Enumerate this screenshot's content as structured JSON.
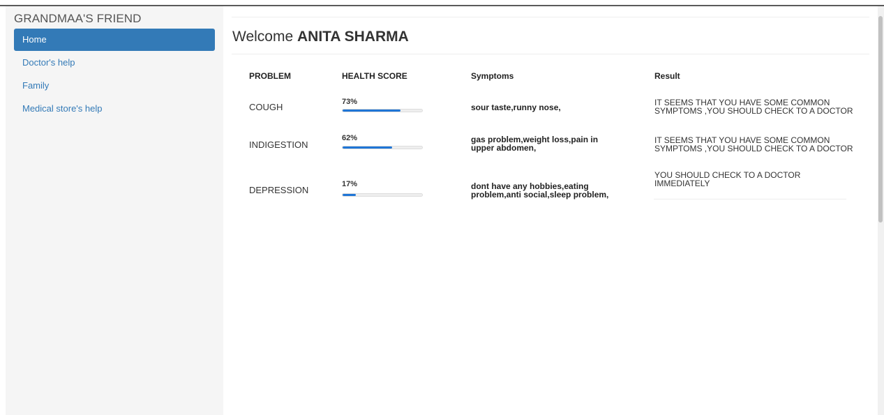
{
  "brand": "GRANDMAA'S FRIEND",
  "nav": [
    {
      "label": "Home",
      "active": true
    },
    {
      "label": "Doctor's help",
      "active": false
    },
    {
      "label": "Family",
      "active": false
    },
    {
      "label": "Medical store's help",
      "active": false
    }
  ],
  "welcome": {
    "prefix": "Welcome",
    "name": "ANITA SHARMA"
  },
  "table": {
    "headers": {
      "problem": "PROBLEM",
      "score": "HEALTH SCORE",
      "symptoms": "Symptoms",
      "result": "Result"
    },
    "rows": [
      {
        "problem": "COUGH",
        "score_label": "73%",
        "score": 73,
        "symptoms": "sour taste,runny nose,",
        "result": "IT SEEMS THAT YOU HAVE SOME COMMON SYMPTOMS ,YOU SHOULD CHECK TO A DOCTOR"
      },
      {
        "problem": "INDIGESTION",
        "score_label": "62%",
        "score": 62,
        "symptoms": "gas problem,weight loss,pain in upper abdomen,",
        "result": "IT SEEMS THAT YOU HAVE SOME COMMON SYMPTOMS ,YOU SHOULD CHECK TO A DOCTOR"
      },
      {
        "problem": "DEPRESSION",
        "score_label": "17%",
        "score": 17,
        "symptoms": "dont have any hobbies,eating problem,anti social,sleep problem,",
        "result": "YOU SHOULD CHECK TO A DOCTOR IMMEDIATELY"
      }
    ]
  },
  "colors": {
    "accent": "#337ab7",
    "progress": "#1f75d6",
    "sidebar_bg": "#f5f5f5"
  }
}
